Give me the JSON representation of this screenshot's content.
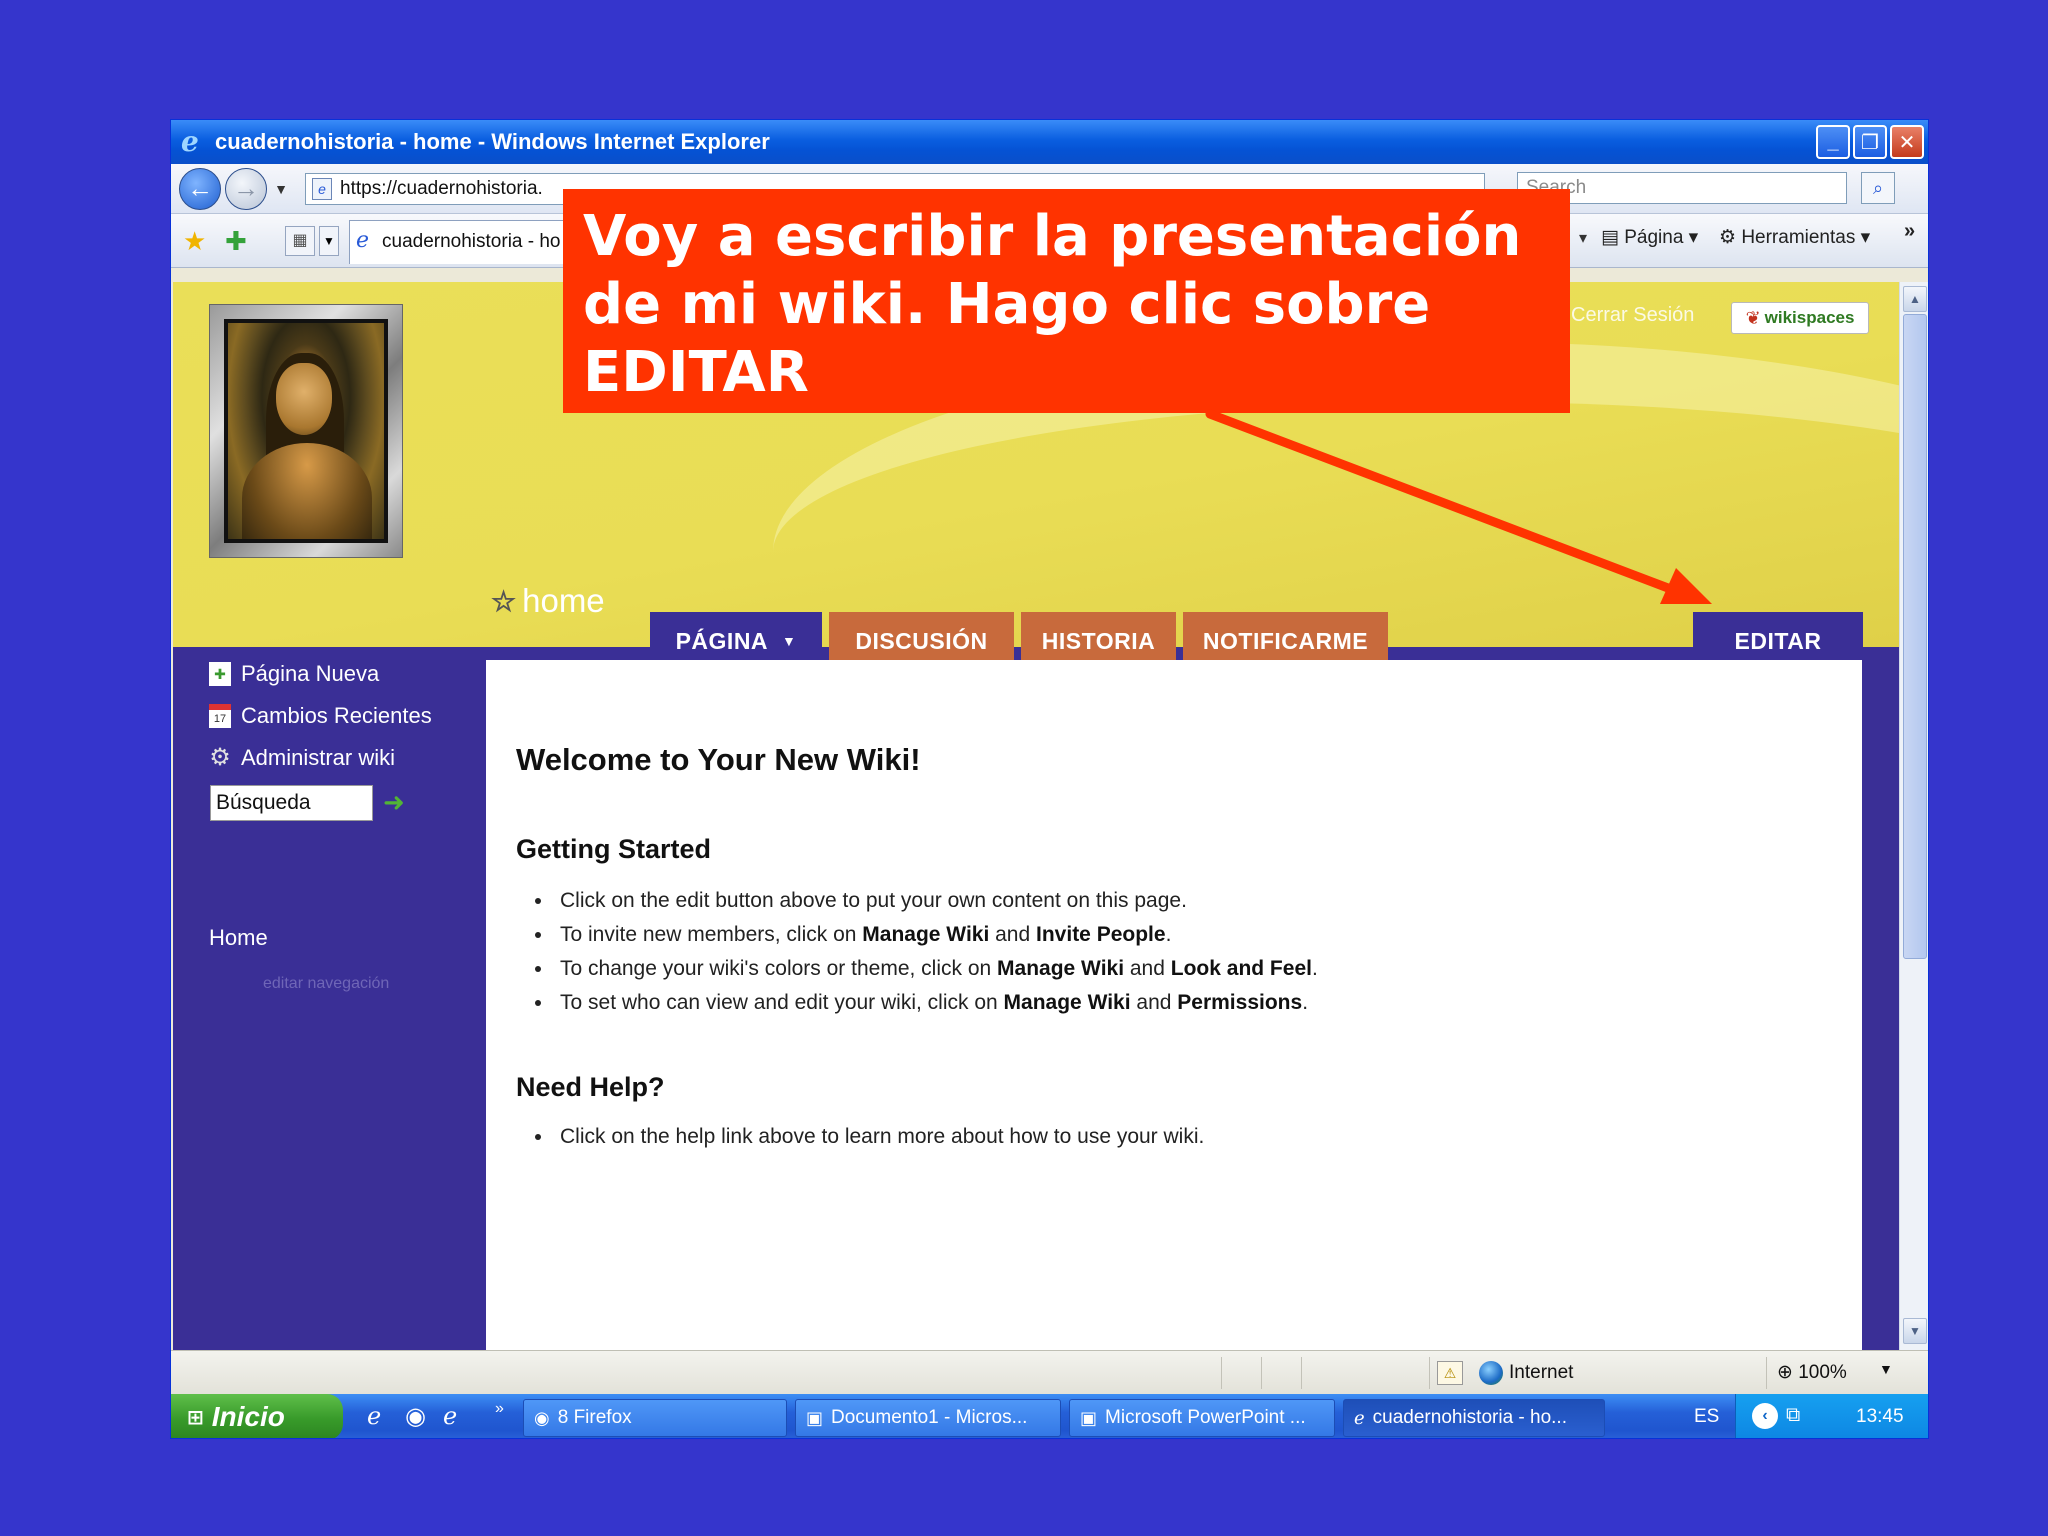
{
  "browser": {
    "window_title": "cuadernohistoria - home - Windows Internet Explorer",
    "url": "https://cuadernohistoria.",
    "search_placeholder": "Search",
    "tab_title": "cuadernohistoria - ho",
    "cmd_pagina": "Página",
    "cmd_herramientas": "Herramientas",
    "status_zone": "Internet",
    "zoom": "100%"
  },
  "header": {
    "cerrar_sesion": "Cerrar Sesión",
    "badge": "wikispaces",
    "page_title": "home"
  },
  "nav": {
    "pagina": "PÁGINA",
    "discusion": "DISCUSIÓN",
    "historia": "HISTORIA",
    "notificarme": "NOTIFICARME",
    "editar": "EDITAR"
  },
  "sidebar": {
    "items": [
      {
        "label": "Página Nueva",
        "icon": "new-page-icon"
      },
      {
        "label": "Cambios Recientes",
        "icon": "calendar-icon"
      },
      {
        "label": "Administrar wiki",
        "icon": "gear-icon"
      }
    ],
    "search_value": "Búsqueda",
    "home_link": "Home",
    "edit_nav": "editar navegación"
  },
  "content": {
    "title": "Welcome to Your New Wiki!",
    "getting_started": {
      "heading": "Getting Started",
      "items": [
        {
          "pre": "Click on the edit button above to put your own content on this page.",
          "b1": "",
          "mid": "",
          "b2": "",
          "post": ""
        },
        {
          "pre": "To invite new members, click on ",
          "b1": "Manage Wiki",
          "mid": " and ",
          "b2": "Invite People",
          "post": "."
        },
        {
          "pre": "To change your wiki's colors or theme, click on ",
          "b1": "Manage Wiki",
          "mid": " and ",
          "b2": "Look and Feel",
          "post": "."
        },
        {
          "pre": "To set who can view and edit your wiki, click on ",
          "b1": "Manage Wiki",
          "mid": " and ",
          "b2": "Permissions",
          "post": "."
        }
      ]
    },
    "need_help": {
      "heading": "Need Help?",
      "items": [
        "Click on the help link above to learn more about how to use your wiki."
      ]
    }
  },
  "taskbar": {
    "start": "Inicio",
    "tasks": [
      "8 Firefox",
      "Documento1 - Micros...",
      "Microsoft PowerPoint ...",
      "cuadernohistoria - ho..."
    ],
    "lang": "ES",
    "clock": "13:45"
  },
  "annotation": {
    "text": "Voy a escribir la presentación de mi wiki. Hago clic sobre EDITAR",
    "color": "#ff3300"
  },
  "colors": {
    "background": "#3535cc",
    "header_yellow": "#eadf58",
    "nav_purple": "#3a2f96",
    "tab_orange": "#c86a3c"
  }
}
